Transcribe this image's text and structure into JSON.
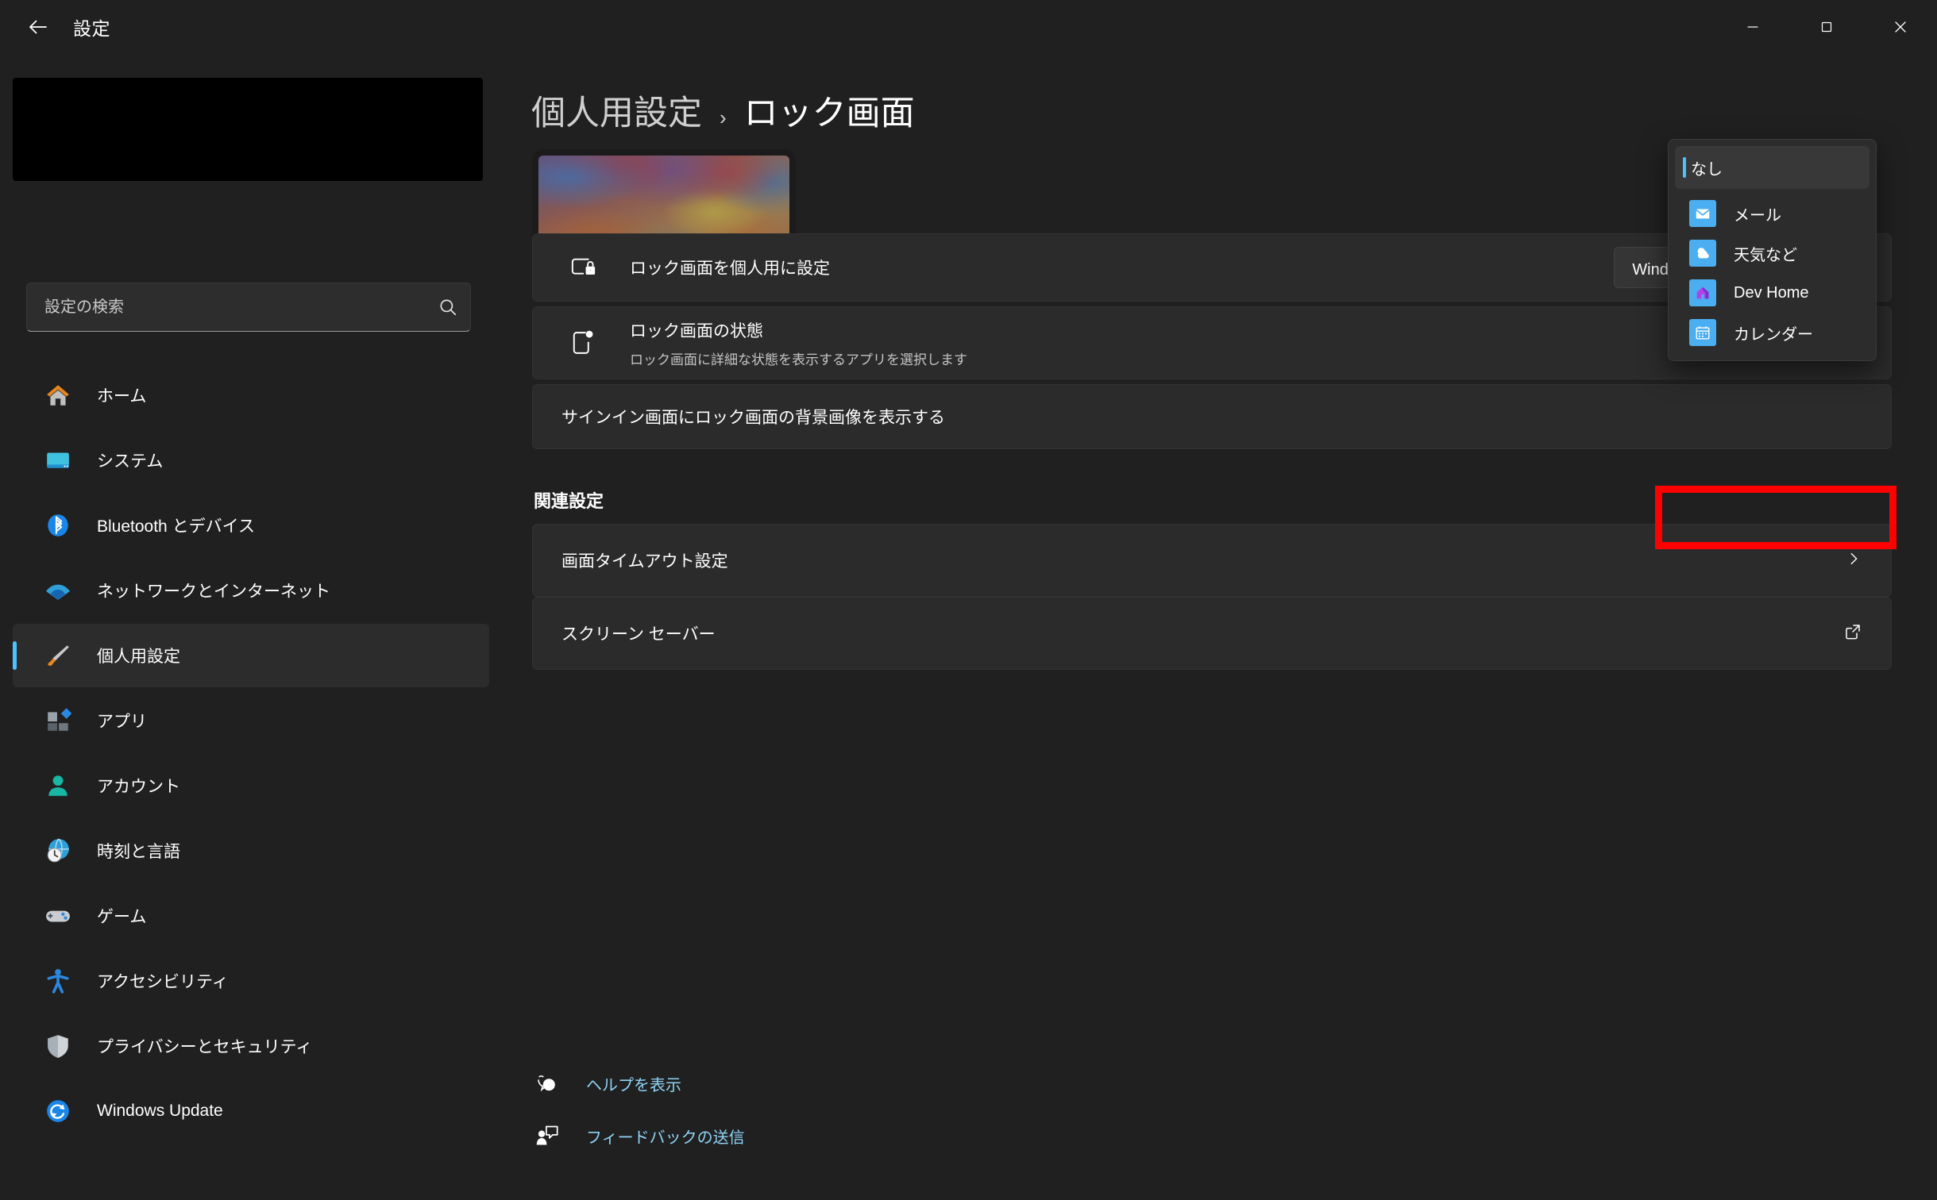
{
  "window": {
    "title": "設定",
    "back_icon": "back-arrow-icon",
    "controls": [
      {
        "name": "minimize-button",
        "icon": "minimize-icon"
      },
      {
        "name": "maximize-button",
        "icon": "maximize-icon"
      },
      {
        "name": "close-button",
        "icon": "close-icon"
      }
    ]
  },
  "sidebar": {
    "search": {
      "placeholder": "設定の検索",
      "value": "",
      "icon": "search-icon"
    },
    "items": [
      {
        "label": "ホーム",
        "icon": "home-icon",
        "selected": false
      },
      {
        "label": "システム",
        "icon": "system-monitor-icon",
        "selected": false
      },
      {
        "label": "Bluetooth とデバイス",
        "icon": "bluetooth-icon",
        "selected": false
      },
      {
        "label": "ネットワークとインターネット",
        "icon": "wifi-icon",
        "selected": false
      },
      {
        "label": "個人用設定",
        "icon": "paintbrush-icon",
        "selected": true
      },
      {
        "label": "アプリ",
        "icon": "apps-icon",
        "selected": false
      },
      {
        "label": "アカウント",
        "icon": "account-person-icon",
        "selected": false
      },
      {
        "label": "時刻と言語",
        "icon": "clock-globe-icon",
        "selected": false
      },
      {
        "label": "ゲーム",
        "icon": "gamepad-icon",
        "selected": false
      },
      {
        "label": "アクセシビリティ",
        "icon": "accessibility-icon",
        "selected": false
      },
      {
        "label": "プライバシーとセキュリティ",
        "icon": "shield-icon",
        "selected": false
      },
      {
        "label": "Windows Update",
        "icon": "update-refresh-icon",
        "selected": false
      }
    ]
  },
  "breadcrumb": {
    "parent": "個人用設定",
    "separator": "›",
    "current": "ロック画面"
  },
  "main": {
    "preview_name": "lock-screen-preview",
    "settings": [
      {
        "title": "ロック画面を個人用に設定",
        "subtitle": "",
        "icon": "lock-screen-icon",
        "control": "combo",
        "value": "Windows スポットライト",
        "chevron": "chevron-down-icon"
      },
      {
        "title": "ロック画面の状態",
        "subtitle": "ロック画面に詳細な状態を表示するアプリを選択します",
        "icon": "lock-status-icon",
        "control": "combo-open",
        "value": "なし"
      },
      {
        "title": "サインイン画面にロック画面の背景画像を表示する",
        "subtitle": "",
        "icon": "",
        "control": "none",
        "value": ""
      }
    ],
    "related_heading": "関連設定",
    "related": [
      {
        "title": "画面タイムアウト設定",
        "icon": "",
        "action_icon": "chevron-right-icon"
      },
      {
        "title": "スクリーン セーバー",
        "icon": "",
        "action_icon": "external-link-icon"
      }
    ],
    "footer_links": [
      {
        "label": "ヘルプを表示",
        "icon": "help-question-icon"
      },
      {
        "label": "フィードバックの送信",
        "icon": "feedback-person-icon"
      }
    ]
  },
  "dropdown": {
    "open": true,
    "selected": "なし",
    "items": [
      {
        "label": "メール",
        "icon": "mail-app-icon"
      },
      {
        "label": "天気など",
        "icon": "weather-app-icon"
      },
      {
        "label": "Dev Home",
        "icon": "dev-home-app-icon"
      },
      {
        "label": "カレンダー",
        "icon": "calendar-app-icon"
      }
    ]
  },
  "annotation": {
    "highlight_color": "#ff0000",
    "target": "ロック画面の状態 ドロップダウン"
  },
  "colors": {
    "window_bg": "#202020",
    "card_bg": "#2b2b2b",
    "accent": "#4cc2ff",
    "link": "#8fd3f4",
    "highlight": "#ff0000"
  }
}
